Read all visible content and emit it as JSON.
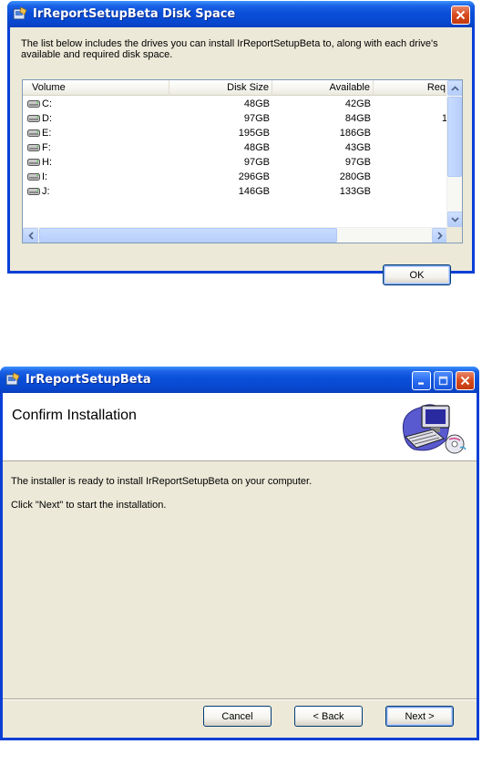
{
  "disk_space_dialog": {
    "title": "IrReportSetupBeta Disk Space",
    "intro_text": "The list below includes the drives you can install IrReportSetupBeta to, along with each drive's available and required disk space.",
    "columns": [
      "Volume",
      "Disk Size",
      "Available",
      "Req"
    ],
    "drives": [
      {
        "volume": "C:",
        "disk_size": "48GB",
        "available": "42GB",
        "required": ""
      },
      {
        "volume": "D:",
        "disk_size": "97GB",
        "available": "84GB",
        "required": "1"
      },
      {
        "volume": "E:",
        "disk_size": "195GB",
        "available": "186GB",
        "required": ""
      },
      {
        "volume": "F:",
        "disk_size": "48GB",
        "available": "43GB",
        "required": ""
      },
      {
        "volume": "H:",
        "disk_size": "97GB",
        "available": "97GB",
        "required": ""
      },
      {
        "volume": "I:",
        "disk_size": "296GB",
        "available": "280GB",
        "required": ""
      },
      {
        "volume": "J:",
        "disk_size": "146GB",
        "available": "133GB",
        "required": ""
      }
    ],
    "ok_label": "OK"
  },
  "confirm_dialog": {
    "title": "IrReportSetupBeta",
    "banner_title": "Confirm Installation",
    "body_line_1": "The installer is ready to install IrReportSetupBeta on your computer.",
    "body_line_2": "Click \"Next\" to start the installation.",
    "cancel_label": "Cancel",
    "back_label": "< Back",
    "next_label": "Next >"
  },
  "icons": [
    "setup-app-icon",
    "close-icon",
    "minimize-icon",
    "maximize-icon",
    "drive-icon",
    "scroll-up-icon",
    "scroll-down-icon",
    "scroll-left-icon",
    "scroll-right-icon",
    "computer-setup-icon"
  ],
  "colors": {
    "titlebar": "#0a4fd9",
    "client": "#ece9d8",
    "close": "#d6491c",
    "listview_border": "#7f9db9"
  }
}
